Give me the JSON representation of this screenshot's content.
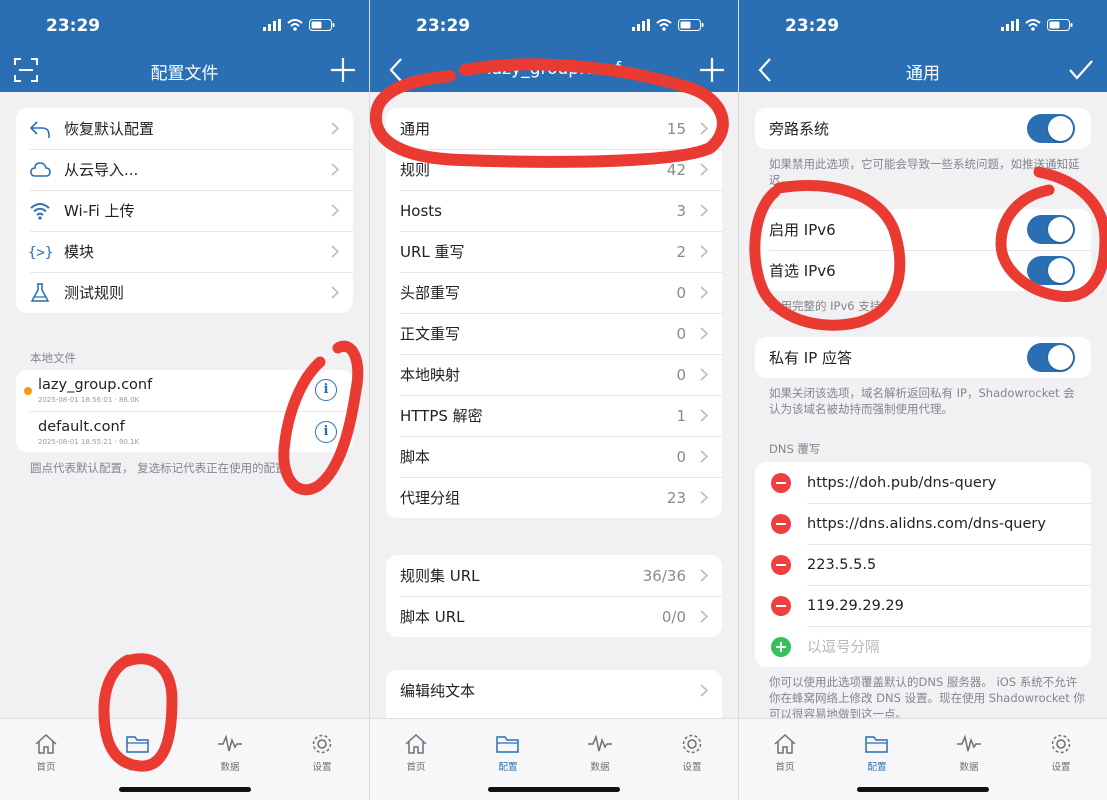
{
  "status_time": "23:29",
  "tabs": [
    "首页",
    "配置",
    "数据",
    "设置"
  ],
  "screen1": {
    "title": "配置文件",
    "menu": [
      {
        "label": "恢复默认配置",
        "icon": "undo-icon"
      },
      {
        "label": "从云导入...",
        "icon": "cloud-icon"
      },
      {
        "label": "Wi-Fi 上传",
        "icon": "wifi-icon"
      },
      {
        "label": "模块",
        "icon": "module-icon"
      },
      {
        "label": "测试规则",
        "icon": "flask-icon"
      }
    ],
    "local_label": "本地文件",
    "files": [
      {
        "name": "lazy_group.conf",
        "meta": "2025-08-01 18:56:01 · 86.0K"
      },
      {
        "name": "default.conf",
        "meta": "2025-08-01 18:55:21 · 90.1K"
      }
    ],
    "note": "圆点代表默认配置， 复选标记代表正在使用的配置。"
  },
  "screen2": {
    "title": "lazy_group.conf",
    "rows": [
      {
        "label": "通用",
        "value": "15"
      },
      {
        "label": "规则",
        "value": "42"
      },
      {
        "label": "Hosts",
        "value": "3"
      },
      {
        "label": "URL 重写",
        "value": "2"
      },
      {
        "label": "头部重写",
        "value": "0"
      },
      {
        "label": "正文重写",
        "value": "0"
      },
      {
        "label": "本地映射",
        "value": "0"
      },
      {
        "label": "HTTPS 解密",
        "value": "1"
      },
      {
        "label": "脚本",
        "value": "0"
      },
      {
        "label": "代理分组",
        "value": "23"
      }
    ],
    "rows2": [
      {
        "label": "规则集 URL",
        "value": "36/36"
      },
      {
        "label": "脚本 URL",
        "value": "0/0"
      }
    ],
    "edit_label": "编辑纯文本"
  },
  "screen3": {
    "title": "通用",
    "bypass_label": "旁路系统",
    "bypass_note": "如果禁用此选项，它可能会导致一些系统问题，如推送通知延迟。",
    "ipv6_enable": "启用 IPv6",
    "ipv6_prefer": "首选 IPv6",
    "ipv6_note": "启用完整的 IPv6 支持",
    "private_ip_label": "私有 IP 应答",
    "private_ip_note": "如果关闭该选项，域名解析返回私有 IP，Shadowrocket 会认为该域名被劫持而强制使用代理。",
    "dns_label": "DNS 覆写",
    "dns_servers": [
      "https://doh.pub/dns-query",
      "https://dns.alidns.com/dns-query",
      "223.5.5.5",
      "119.29.29.29"
    ],
    "dns_placeholder": "以逗号分隔",
    "dns_note": "你可以使用此选项覆盖默认的DNS 服务器。 iOS 系统不允许你在蜂窝网络上修改 DNS 设置。现在使用 Shadowrocket 你可以很容易地做到这一点。"
  }
}
